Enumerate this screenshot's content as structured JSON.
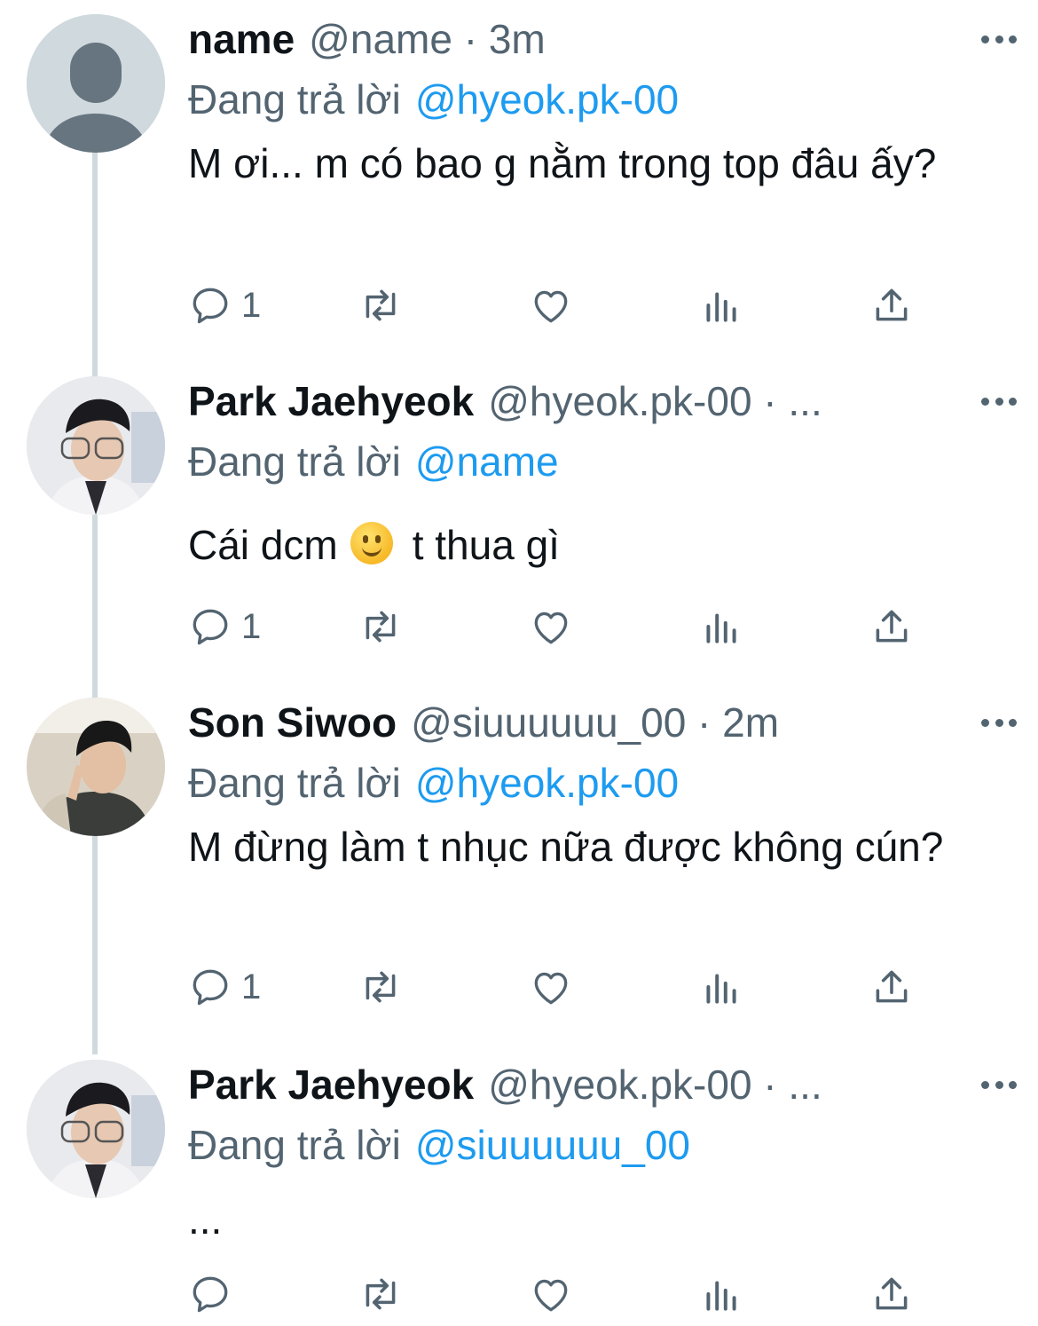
{
  "colors": {
    "accent": "#1d9bf0",
    "muted": "#536471",
    "text": "#0f1419",
    "thread_line": "#cfd9de"
  },
  "tweets": [
    {
      "display_name": "name",
      "handle_meta": "@name · 3m",
      "replying_prefix": "Đang trả lời",
      "replying_to": "@hyeok.pk-00",
      "text": "M ơi... m có bao g nằm trong top đâu ấy?",
      "reply_count": "1",
      "avatar": "default-avatar"
    },
    {
      "display_name": "Park Jaehyeok",
      "handle_meta": "@hyeok.pk-00 · ...",
      "replying_prefix": "Đang trả lời",
      "replying_to": "@name",
      "text_before_emoji": "Cái dcm",
      "emoji": "slightly-smiling-face",
      "text_after_emoji": "t thua gì",
      "reply_count": "1",
      "avatar": "profile-photo"
    },
    {
      "display_name": "Son Siwoo",
      "handle_meta": "@siuuuuuu_00 · 2m",
      "replying_prefix": "Đang trả lời",
      "replying_to": "@hyeok.pk-00",
      "text": "M đừng làm t nhục nữa được không cún?",
      "reply_count": "1",
      "avatar": "profile-photo"
    },
    {
      "display_name": "Park Jaehyeok",
      "handle_meta": "@hyeok.pk-00 · ...",
      "replying_prefix": "Đang trả lời",
      "replying_to": "@siuuuuuu_00",
      "text": "...",
      "reply_count": "",
      "avatar": "profile-photo"
    }
  ],
  "icons": [
    "reply-icon",
    "retweet-icon",
    "like-icon",
    "views-icon",
    "share-icon",
    "more-icon"
  ]
}
